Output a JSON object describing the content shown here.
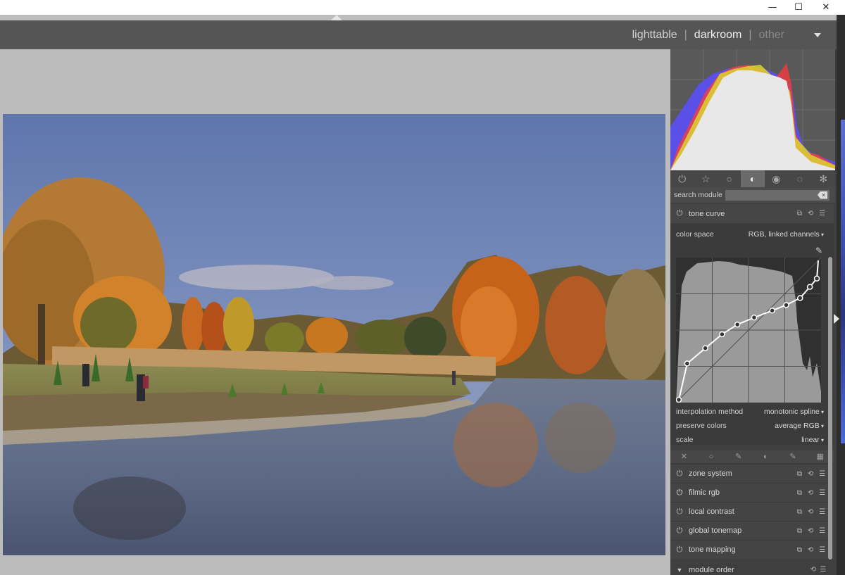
{
  "window": {
    "minimize": "—",
    "maximize": "☐",
    "close": "✕"
  },
  "views": [
    {
      "label": "lighttable",
      "state": "normal"
    },
    {
      "label": "darkroom",
      "state": "active"
    },
    {
      "label": "other",
      "state": "dim"
    }
  ],
  "module_groups": {
    "active_index": 3
  },
  "search": {
    "label": "search module",
    "value": ""
  },
  "tone_curve": {
    "name": "tone curve",
    "color_space_label": "color space",
    "color_space_value": "RGB, linked channels",
    "interpolation_label": "interpolation method",
    "interpolation_value": "monotonic spline",
    "preserve_label": "preserve colors",
    "preserve_value": "average RGB",
    "scale_label": "scale",
    "scale_value": "linear",
    "curve_points": [
      [
        0,
        0
      ],
      [
        0.06,
        0.26
      ],
      [
        0.19,
        0.37
      ],
      [
        0.31,
        0.47
      ],
      [
        0.42,
        0.54
      ],
      [
        0.54,
        0.59
      ],
      [
        0.67,
        0.64
      ],
      [
        0.77,
        0.68
      ],
      [
        0.87,
        0.73
      ],
      [
        0.94,
        0.81
      ],
      [
        0.99,
        0.87
      ],
      [
        1.0,
        1.0
      ]
    ]
  },
  "modules": [
    {
      "name": "zone system",
      "on": false
    },
    {
      "name": "filmic rgb",
      "on": true
    },
    {
      "name": "local contrast",
      "on": false
    },
    {
      "name": "global tonemap",
      "on": false
    },
    {
      "name": "tone mapping",
      "on": false
    }
  ],
  "module_order": {
    "name": "module order"
  }
}
